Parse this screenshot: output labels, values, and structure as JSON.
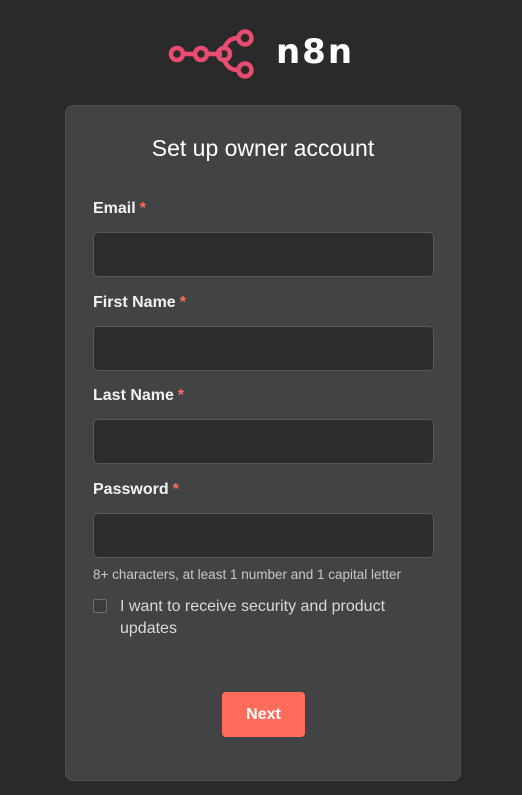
{
  "brand": {
    "name": "n8n",
    "logo_icon": "n8n-node-graph-icon",
    "accent_color": "#ea4b71"
  },
  "form": {
    "title": "Set up owner account",
    "required_marker": "*",
    "fields": [
      {
        "label": "Email",
        "value": "",
        "placeholder": ""
      },
      {
        "label": "First Name",
        "value": "",
        "placeholder": ""
      },
      {
        "label": "Last Name",
        "value": "",
        "placeholder": ""
      },
      {
        "label": "Password",
        "value": "",
        "placeholder": "",
        "hint": "8+ characters, at least 1 number and 1 capital letter"
      }
    ],
    "checkbox": {
      "label": "I want to receive security and product updates",
      "checked": false
    },
    "submit_label": "Next",
    "submit_color": "#ff6d5a"
  }
}
